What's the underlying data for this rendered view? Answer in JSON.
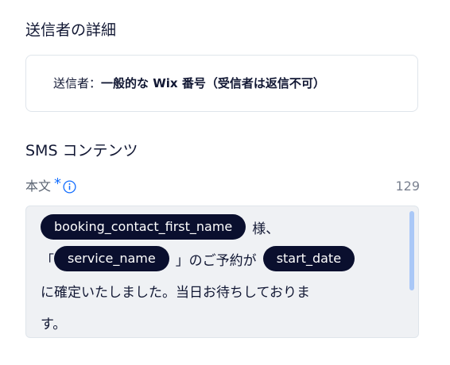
{
  "sender_section": {
    "title": "送信者の詳細",
    "label": "送信者：",
    "value": "一般的な Wix 番号（受信者は返信不可）"
  },
  "sms": {
    "heading": "SMS コンテンツ",
    "body_label": "本文",
    "required_mark": "*",
    "char_count": "129",
    "tokens": {
      "first_name": "booking_contact_first_name",
      "service": "service_name",
      "date": "start_date"
    },
    "text": {
      "after_first_name": "様、",
      "open_bracket": "「",
      "close_bracket_and_text": "」のご予約が",
      "line3": "に確定いたしました。当日お待ちしておりま",
      "line4": "す。"
    }
  },
  "icons": {
    "info": "info-icon"
  },
  "colors": {
    "accent": "#116dff",
    "chip_bg": "#0a0f2e",
    "editor_bg": "#eff1f4"
  }
}
